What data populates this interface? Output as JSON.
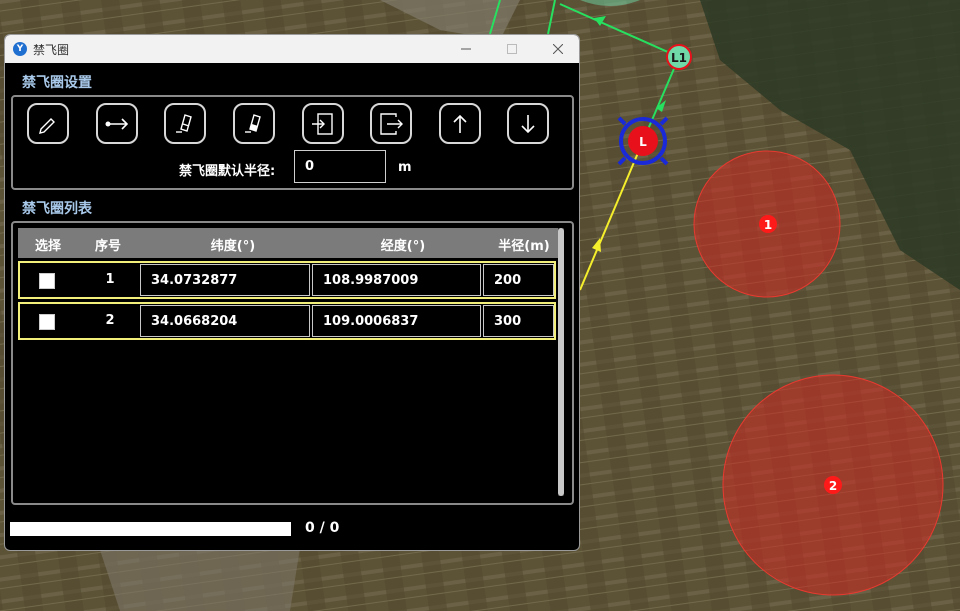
{
  "window": {
    "title": "禁飞圈",
    "app_icon_glyph": "Y"
  },
  "settings": {
    "title": "禁飞圈设置",
    "tools": [
      "pencil-icon",
      "arrow-right-icon",
      "erase-one-icon",
      "erase-all-icon",
      "import-icon",
      "export-icon",
      "arrow-up-icon",
      "arrow-down-icon"
    ],
    "radius_label": "禁飞圈默认半径:",
    "radius_value": "0",
    "radius_unit": "m"
  },
  "list": {
    "title": "禁飞圈列表",
    "columns": [
      "选择",
      "序号",
      "纬度(°)",
      "经度(°)",
      "半径(m)"
    ],
    "rows": [
      {
        "checked": false,
        "index": "1",
        "lat": "34.0732877",
        "lon": "108.9987009",
        "radius": "200"
      },
      {
        "checked": false,
        "index": "2",
        "lat": "34.0668204",
        "lon": "109.0006837",
        "radius": "300"
      }
    ]
  },
  "progress": {
    "text": "0 / 0",
    "value": 0
  },
  "map": {
    "markers": [
      {
        "label": "L1",
        "color": "#6fd9a8"
      },
      {
        "label": "L",
        "color": "#e8101a"
      },
      {
        "label": "1",
        "color": "#ff1a1a"
      },
      {
        "label": "2",
        "color": "#ff1a1a"
      }
    ],
    "colors": {
      "route_green": "#27e05f",
      "route_yellow": "#f4ee2c",
      "zone_fill": "#d22a22",
      "target_ring": "#1a2ad8"
    }
  }
}
